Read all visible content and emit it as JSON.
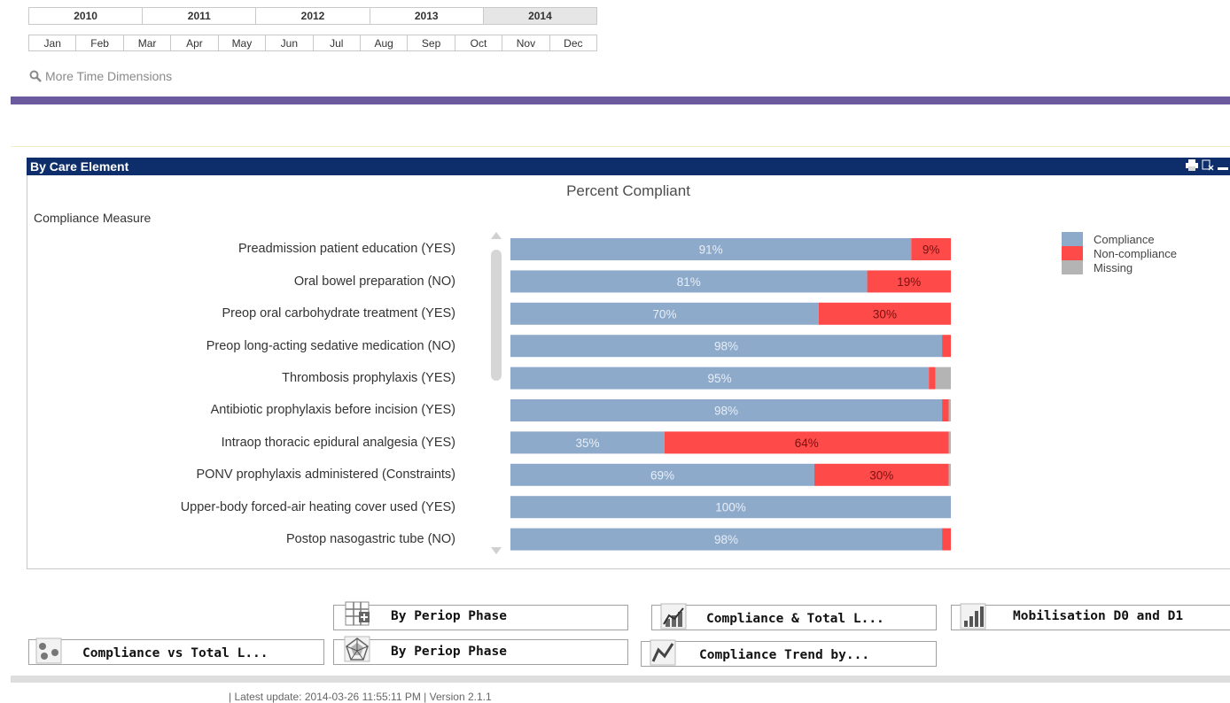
{
  "time": {
    "years": [
      "2010",
      "2011",
      "2012",
      "2013",
      "2014"
    ],
    "selected_year": "2014",
    "months": [
      "Jan",
      "Feb",
      "Mar",
      "Apr",
      "May",
      "Jun",
      "Jul",
      "Aug",
      "Sep",
      "Oct",
      "Nov",
      "Dec"
    ],
    "more_dimensions": "More Time Dimensions"
  },
  "panel": {
    "title": "By Care Element",
    "dimension_label": "Compliance Measure",
    "icons": [
      "printer-icon",
      "clear-selection-icon",
      "minimize-icon"
    ]
  },
  "chart_data": {
    "type": "bar",
    "orientation": "horizontal-stacked-percent",
    "title": "Percent Compliant",
    "categories": [
      "Preadmission patient education (YES)",
      "Oral bowel preparation (NO)",
      "Preop oral carbohydrate treatment (YES)",
      "Preop long-acting sedative medication (NO)",
      "Thrombosis prophylaxis (YES)",
      "Antibiotic prophylaxis before incision (YES)",
      "Intraop thoracic epidural analgesia (YES)",
      "PONV prophylaxis administered (Constraints)",
      "Upper-body forced-air heating cover used (YES)",
      "Postop nasogastric tube (NO)"
    ],
    "series": [
      {
        "name": "Compliance",
        "color": "#8eaacb",
        "values": [
          91,
          81,
          70,
          98,
          95,
          98,
          35,
          69,
          100,
          98
        ],
        "labels": [
          "91%",
          "81%",
          "70%",
          "98%",
          "95%",
          "98%",
          "35%",
          "69%",
          "100%",
          "98%"
        ]
      },
      {
        "name": "Non-compliance",
        "color": "#ff4a4a",
        "values": [
          9,
          19,
          30,
          2,
          1.5,
          1.5,
          64.5,
          30.5,
          0,
          2
        ],
        "labels": [
          "9%",
          "19%",
          "30%",
          "",
          "",
          "",
          "64%",
          "30%",
          "",
          ""
        ]
      },
      {
        "name": "Missing",
        "color": "#b4b4b4",
        "values": [
          0,
          0,
          0,
          0,
          3.5,
          0.5,
          0.5,
          0.5,
          0,
          0
        ],
        "labels": [
          "",
          "",
          "",
          "",
          "",
          "",
          "",
          "",
          "",
          ""
        ]
      }
    ],
    "xlim": [
      0,
      100
    ],
    "legend_position": "right",
    "grid": false
  },
  "buttons": [
    {
      "label": "By Periop Phase",
      "icon": "pivot-table-icon"
    },
    {
      "label": "Compliance & Total L...",
      "icon": "combo-chart-icon"
    },
    {
      "label": "Mobilisation D0 and D1",
      "icon": "bar-chart-icon"
    },
    {
      "label": "Compliance vs Total L...",
      "icon": "scatter-chart-icon"
    },
    {
      "label": "By Periop Phase",
      "icon": "radar-chart-icon"
    },
    {
      "label": "Compliance Trend by...",
      "icon": "line-chart-icon"
    }
  ],
  "footer": {
    "text": "| Latest update: 2014-03-26 11:55:11 PM  |  Version 2.1.1"
  }
}
